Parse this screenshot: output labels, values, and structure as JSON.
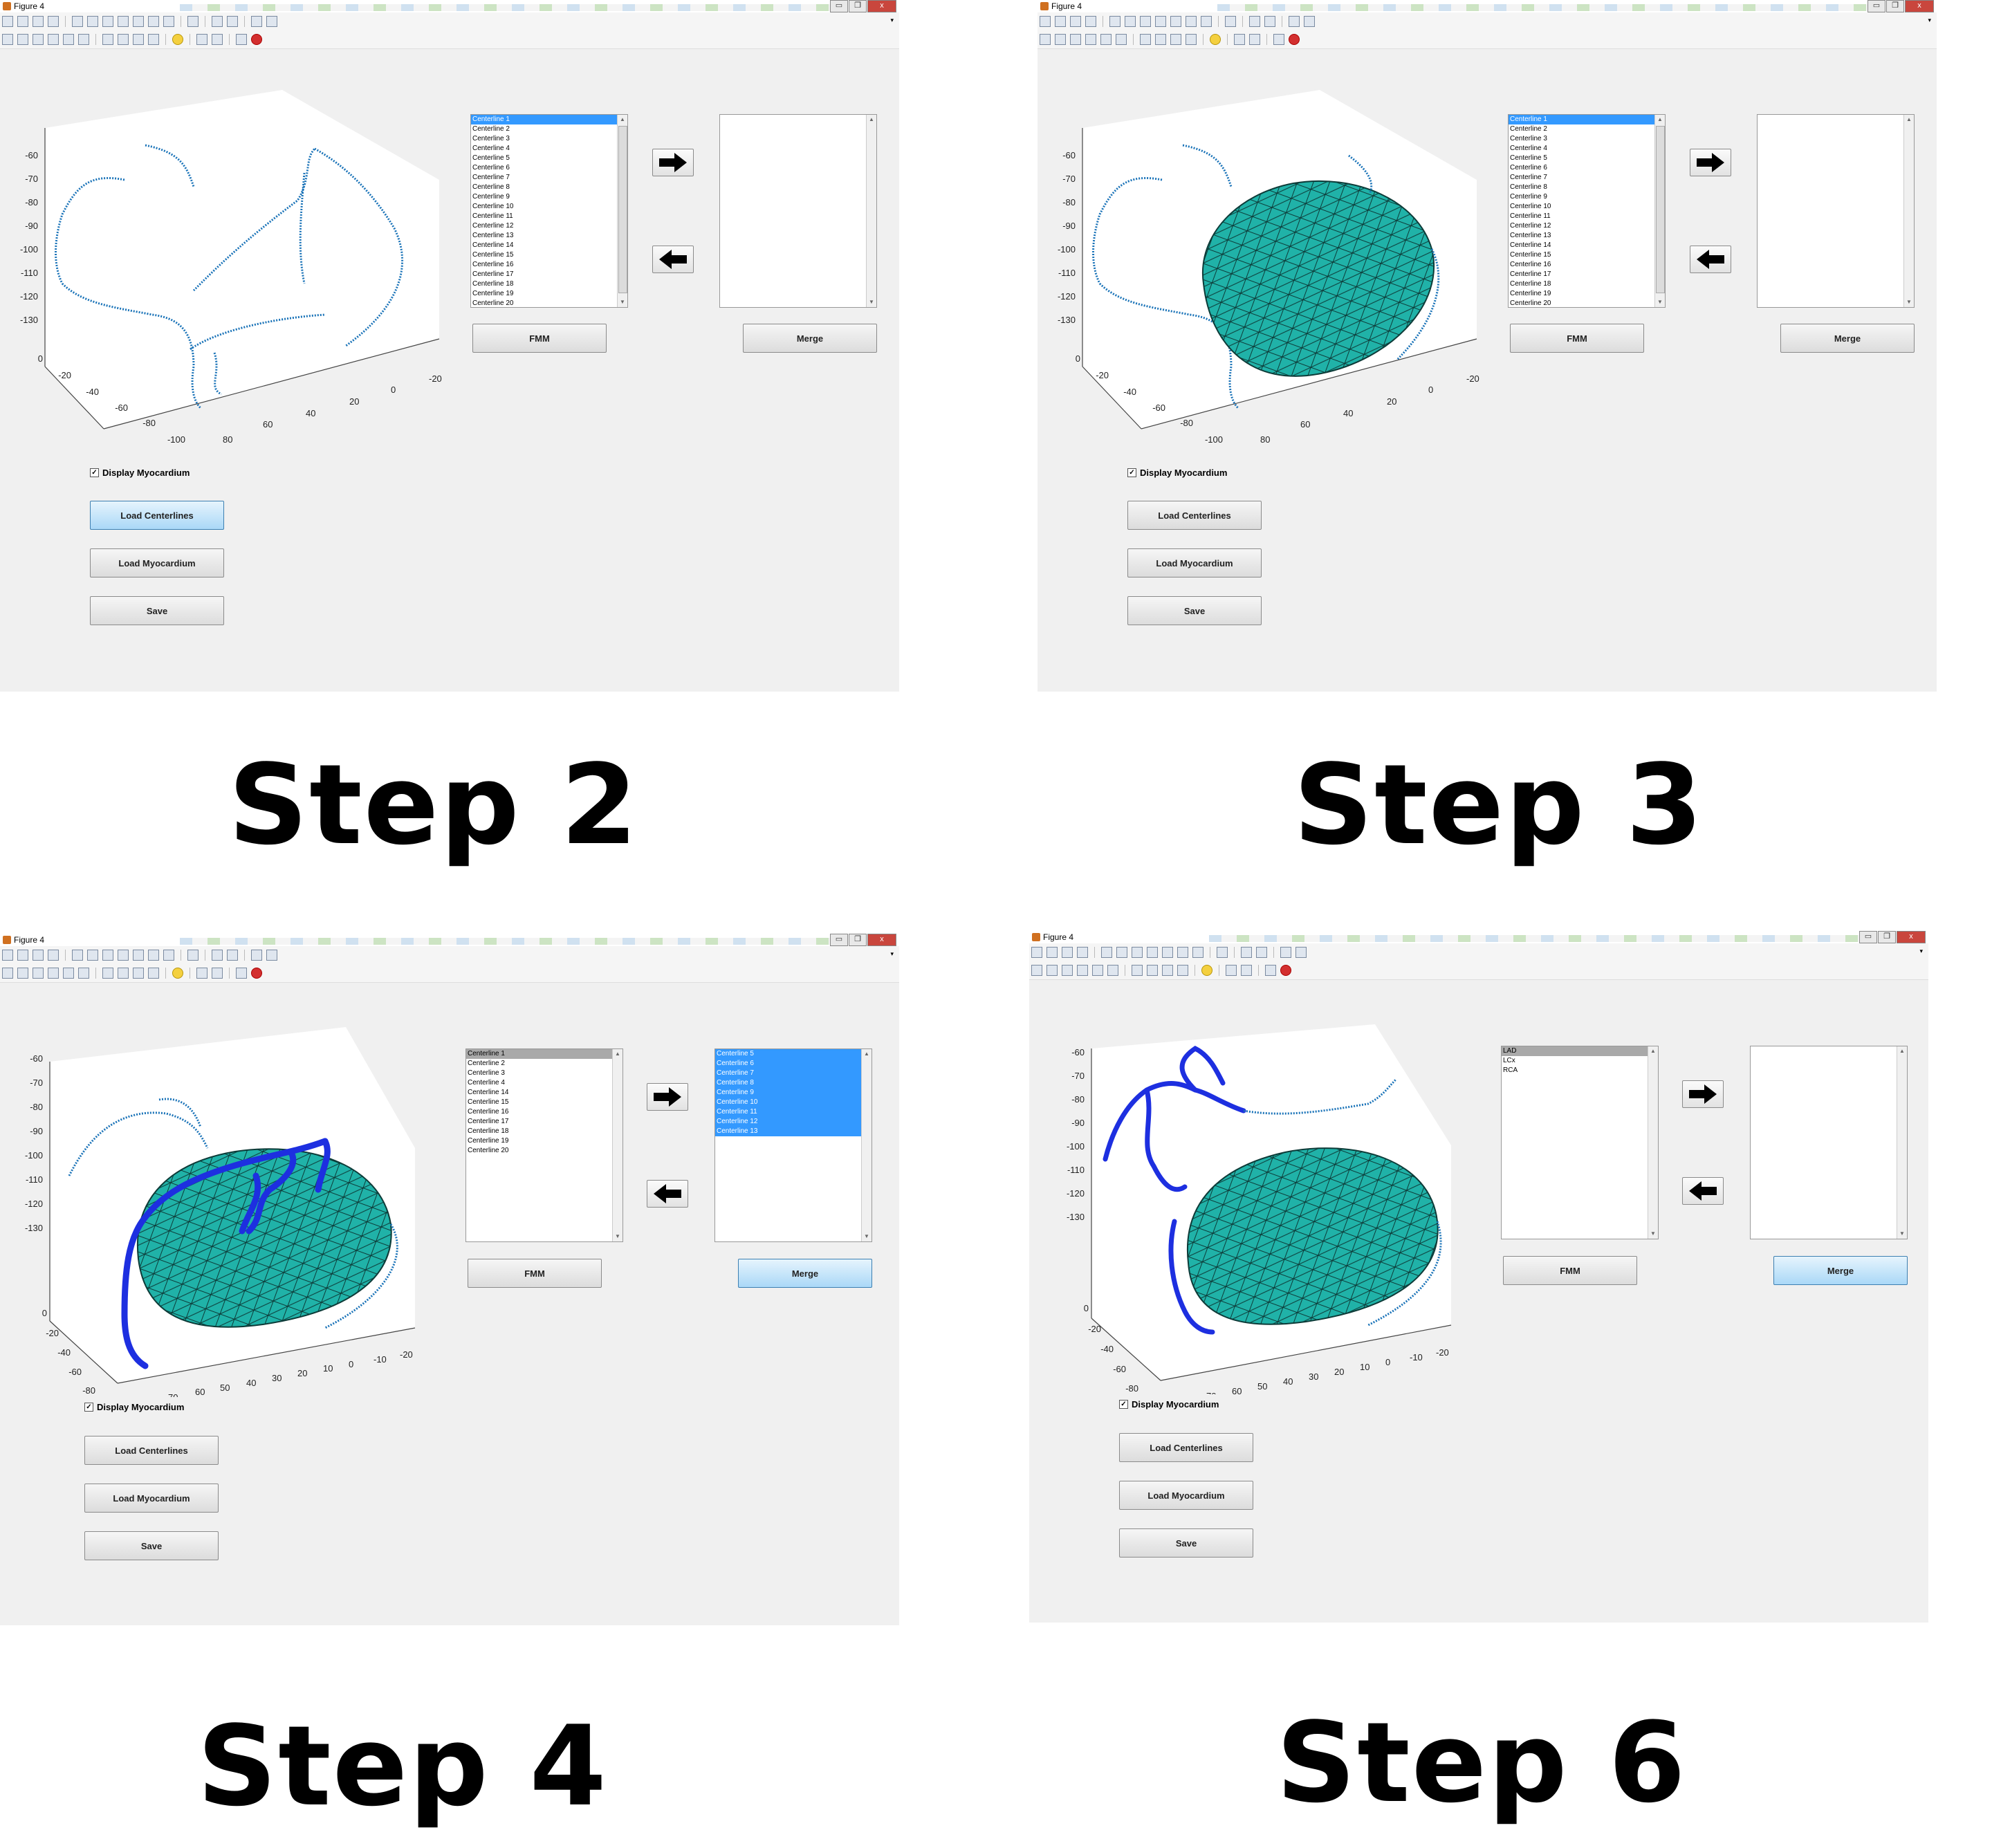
{
  "window": {
    "title": "Figure 4",
    "controls": [
      "▭",
      "❐",
      "x"
    ]
  },
  "axis": {
    "z_ticks": [
      "-60",
      "-70",
      "-80",
      "-90",
      "-100",
      "-110",
      "-120",
      "-130"
    ],
    "y_ticks": [
      "0",
      "-20",
      "-40",
      "-60",
      "-80",
      "-100"
    ],
    "x_ticks_coarse": [
      "80",
      "60",
      "40",
      "20",
      "0",
      "-20"
    ],
    "x_ticks_fine": [
      "80",
      "70",
      "60",
      "50",
      "40",
      "30",
      "20",
      "10",
      "0",
      "-10",
      "-20"
    ]
  },
  "common": {
    "fmm_label": "FMM",
    "merge_label": "Merge",
    "display_myocardium_label": "Display Myocardium",
    "load_centerlines_label": "Load Centerlines",
    "load_myocardium_label": "Load Myocardium",
    "save_label": "Save",
    "right_arrow_icon": "right-arrow-icon",
    "left_arrow_icon": "left-arrow-icon"
  },
  "colors": {
    "selection_blue": "#3399ff",
    "mesh_teal": "#20b2a8",
    "vessel_blue": "#1a73b8",
    "merged_vessel": "#1d2fe0",
    "active_button": "#aad8f7"
  },
  "panels": [
    {
      "step": "Step 2",
      "left_list": [
        "Centerline 1",
        "Centerline 2",
        "Centerline 3",
        "Centerline 4",
        "Centerline 5",
        "Centerline 6",
        "Centerline 7",
        "Centerline 8",
        "Centerline 9",
        "Centerline 10",
        "Centerline 11",
        "Centerline 12",
        "Centerline 13",
        "Centerline 14",
        "Centerline 15",
        "Centerline 16",
        "Centerline 17",
        "Centerline 18",
        "Centerline 19",
        "Centerline 20"
      ],
      "left_selected": [
        0
      ],
      "right_list": [],
      "display_myocardium": true
    },
    {
      "step": "Step 3",
      "left_list": [
        "Centerline 1",
        "Centerline 2",
        "Centerline 3",
        "Centerline 4",
        "Centerline 5",
        "Centerline 6",
        "Centerline 7",
        "Centerline 8",
        "Centerline 9",
        "Centerline 10",
        "Centerline 11",
        "Centerline 12",
        "Centerline 13",
        "Centerline 14",
        "Centerline 15",
        "Centerline 16",
        "Centerline 17",
        "Centerline 18",
        "Centerline 19",
        "Centerline 20"
      ],
      "left_selected": [
        0
      ],
      "right_list": [],
      "display_myocardium": true
    },
    {
      "step": "Step 4",
      "left_list": [
        "Centerline 1",
        "Centerline 2",
        "Centerline 3",
        "Centerline 4",
        "Centerline 14",
        "Centerline 15",
        "Centerline 16",
        "Centerline 17",
        "Centerline 18",
        "Centerline 19",
        "Centerline 20"
      ],
      "left_selected": [
        0
      ],
      "right_list": [
        "Centerline 5",
        "Centerline 6",
        "Centerline 7",
        "Centerline 8",
        "Centerline 9",
        "Centerline 10",
        "Centerline 11",
        "Centerline 12",
        "Centerline 13"
      ],
      "right_selected": [
        0,
        1,
        2,
        3,
        4,
        5,
        6,
        7,
        8
      ],
      "display_myocardium": true
    },
    {
      "step": "Step 6",
      "left_list": [
        "LAD",
        "LCx",
        "RCA"
      ],
      "left_selected": [
        0
      ],
      "right_list": [],
      "display_myocardium": true
    }
  ]
}
